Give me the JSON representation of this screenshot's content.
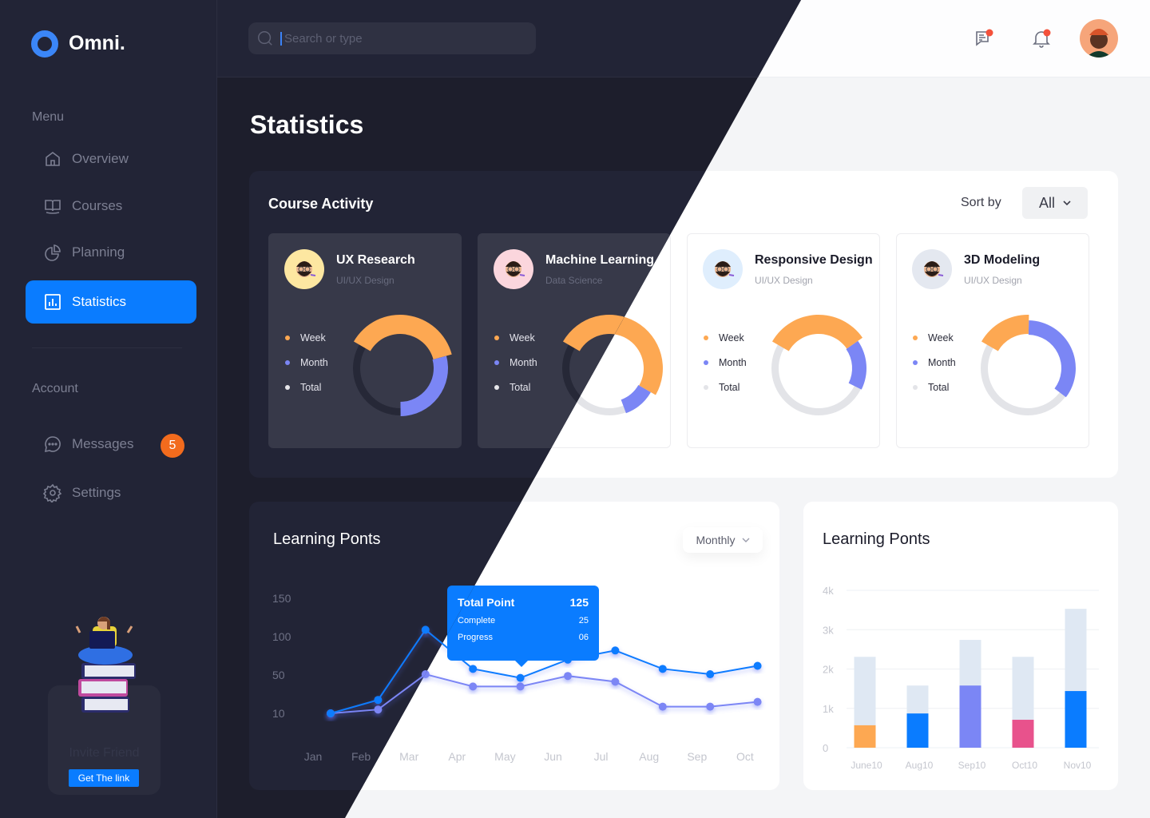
{
  "app": {
    "brand": "Omni."
  },
  "sidebar": {
    "menu_label": "Menu",
    "menu": [
      {
        "label": "Overview",
        "icon": "home-icon"
      },
      {
        "label": "Courses",
        "icon": "book-icon"
      },
      {
        "label": "Planning",
        "icon": "pie-chart-icon"
      },
      {
        "label": "Statistics",
        "icon": "bar-chart-icon",
        "active": true
      }
    ],
    "account_label": "Account",
    "account": [
      {
        "label": "Messages",
        "icon": "chat-bubble-icon",
        "badge": "5"
      },
      {
        "label": "Settings",
        "icon": "gear-icon"
      }
    ],
    "invite": {
      "title": "Invite Friend",
      "button": "Get The link"
    }
  },
  "header": {
    "search_placeholder": "Search or type",
    "icons": [
      "messages-icon",
      "bell-icon"
    ],
    "notification_color": "#f4513b"
  },
  "page": {
    "title": "Statistics"
  },
  "course_activity": {
    "title": "Course Activity",
    "sort_label": "Sort by",
    "sort_value": "All",
    "legend": [
      "Week",
      "Month",
      "Total"
    ],
    "courses": [
      {
        "name": "UX Research",
        "category": "UI/UX Design",
        "avatar_bg": "#fde7a1",
        "week_pct": 37.5,
        "month_pct": 29
      },
      {
        "name": "Machine Learning",
        "category": "Data Science",
        "avatar_bg": "#fbd6dd",
        "week_pct": 50,
        "month_pct": 11
      },
      {
        "name": "Responsive Design",
        "category": "UI/UX Design",
        "avatar_bg": "#dfeefd",
        "week_pct": 32,
        "month_pct": 17
      },
      {
        "name": "3D Modeling",
        "category": "UI/UX Design",
        "avatar_bg": "#e4e8f0",
        "week_pct": 17,
        "month_pct": 35
      }
    ]
  },
  "colors": {
    "accent": "#0a7cff",
    "week": "#fda852",
    "month": "#7b86f5",
    "badge": "#f26b1d",
    "pink": "#e8528c"
  },
  "chart_data": [
    {
      "type": "line",
      "title": "Learning Ponts",
      "filter": "Monthly",
      "categories": [
        "Jan",
        "Feb",
        "Mar",
        "Apr",
        "May",
        "Jun",
        "Jul",
        "Aug",
        "Sep",
        "Oct"
      ],
      "yticks": [
        150,
        100,
        50,
        10
      ],
      "series": [
        {
          "color": "#0a7cff",
          "values": [
            10,
            24,
            109,
            58,
            47,
            70,
            82,
            58,
            51,
            62
          ]
        },
        {
          "color": "#7b86f5",
          "values": [
            10,
            14,
            51,
            38,
            38,
            49,
            43,
            17,
            17,
            22
          ]
        }
      ],
      "tooltip": {
        "category": "May",
        "title": "Total Point",
        "total": "125",
        "rows": [
          {
            "label": "Complete",
            "value": "25"
          },
          {
            "label": "Progress",
            "value": "06"
          }
        ]
      }
    },
    {
      "type": "bar",
      "title": "Learning Ponts",
      "stacked": true,
      "categories": [
        "June10",
        "Aug10",
        "Sep10",
        "Oct10",
        "Nov10"
      ],
      "ytick_labels": [
        "0",
        "1k",
        "2k",
        "3k",
        "4k"
      ],
      "ylim": [
        0,
        4000
      ],
      "grid": true,
      "totals": [
        2310,
        1580,
        2740,
        2310,
        3530
      ],
      "values": [
        570,
        870,
        1580,
        710,
        1440
      ],
      "colors": [
        "#fda852",
        "#0a7cff",
        "#7b86f5",
        "#e8528c",
        "#0a7cff"
      ],
      "total_color": "#dfe8f3"
    }
  ]
}
